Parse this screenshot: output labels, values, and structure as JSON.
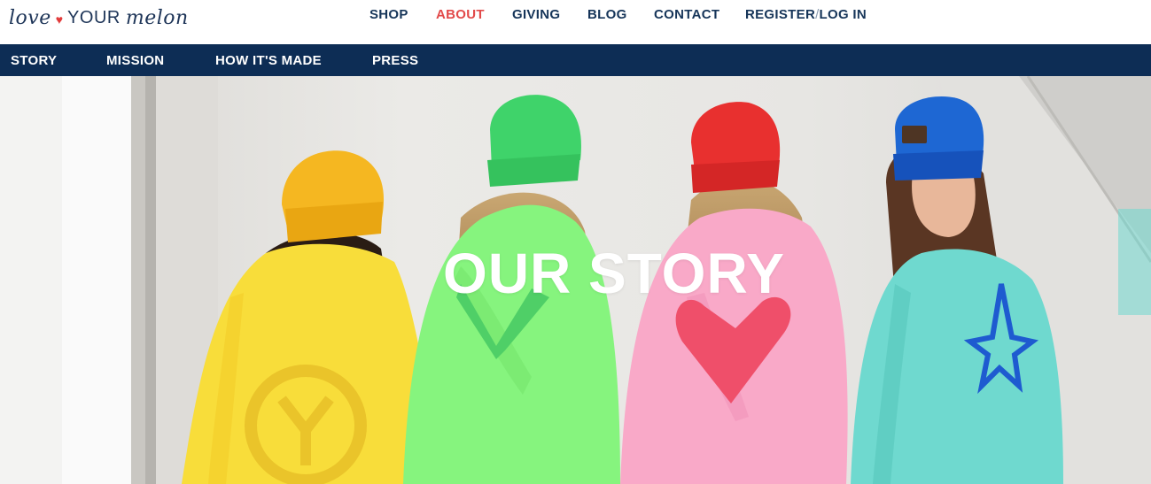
{
  "brand": {
    "logo_love": "love",
    "logo_your": "YOUR",
    "logo_melon": "melon",
    "heart_color": "#e23b3b",
    "navy": "#0d2d55"
  },
  "main_nav": {
    "shop": "SHOP",
    "about": "ABOUT",
    "giving": "GIVING",
    "blog": "BLOG",
    "contact": "CONTACT",
    "register": "REGISTER",
    "separator": "/",
    "login": "LOG IN",
    "active_item": "ABOUT",
    "active_color": "#e24a4a"
  },
  "sub_nav": {
    "story": "STORY",
    "mission": "MISSION",
    "how_its_made": "HOW IT'S MADE",
    "press": "PRESS"
  },
  "hero": {
    "title": "OUR STORY",
    "image_icon": "hero-photo-image",
    "cape_colors": [
      "#f8dd3a",
      "#86f47e",
      "#f9a9c8",
      "#6fd9cf"
    ],
    "beanie_colors": [
      "#f5b721",
      "#3fd36a",
      "#e8302f",
      "#1e67d3"
    ]
  }
}
